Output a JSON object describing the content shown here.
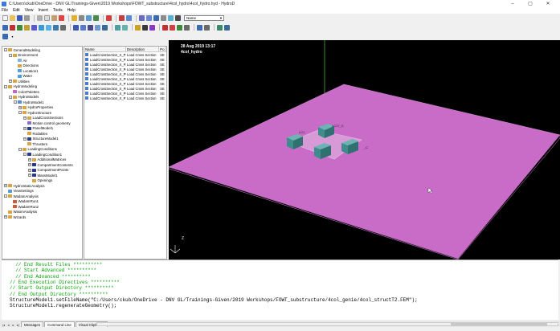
{
  "window": {
    "title": "C:\\Users\\ckub\\OneDrive - DNV GL\\Trainings-Given\\2019 Workshops\\FOWT_substructure\\4col_hydro\\4col_hydro.hyd - HydroD",
    "minimize": "–",
    "maximize": "▢",
    "close": "✕"
  },
  "menu": [
    "File",
    "Edit",
    "View",
    "Insert",
    "Tools",
    "Help"
  ],
  "toolbar": {
    "name_combo_value": "Name"
  },
  "tree": [
    {
      "label": "GeneralModeling",
      "depth": 0,
      "exp": "-",
      "color": "#d9a441"
    },
    {
      "label": "Environment",
      "depth": 1,
      "exp": "-",
      "color": "#d9a441"
    },
    {
      "label": "Air",
      "depth": 2,
      "exp": "",
      "color": "#7fb2e5"
    },
    {
      "label": "Directions",
      "depth": 2,
      "exp": "",
      "color": "#d9a441"
    },
    {
      "label": "Location1",
      "depth": 2,
      "exp": "",
      "color": "#5aa0d8"
    },
    {
      "label": "Water",
      "depth": 2,
      "exp": "",
      "color": "#4aa0e0"
    },
    {
      "label": "Utilities",
      "depth": 1,
      "exp": "+",
      "color": "#d9a441"
    },
    {
      "label": "HydroModeling",
      "depth": 0,
      "exp": "-",
      "color": "#d9a441"
    },
    {
      "label": "ColorPalettes",
      "depth": 1,
      "exp": "",
      "color": "#c06bc0"
    },
    {
      "label": "HydroModels",
      "depth": 1,
      "exp": "-",
      "color": "#d9a441"
    },
    {
      "label": "HydroModel1",
      "depth": 2,
      "exp": "-",
      "color": "#5a8ad0"
    },
    {
      "label": "HydroProperties",
      "depth": 3,
      "exp": "+",
      "color": "#d9a441"
    },
    {
      "label": "HydroStructure",
      "depth": 3,
      "exp": "-",
      "color": "#d9a441"
    },
    {
      "label": "LoadCrossSections",
      "depth": 4,
      "exp": "+",
      "color": "#d9a441"
    },
    {
      "label": "Motion control geometry",
      "depth": 4,
      "exp": "",
      "color": "#8a6ad0"
    },
    {
      "label": "PanelModel1",
      "depth": 4,
      "exp": "+",
      "color": "#2a3a8a"
    },
    {
      "label": "Rodables",
      "depth": 4,
      "exp": "",
      "color": "#d9a441"
    },
    {
      "label": "StructureModel1",
      "depth": 4,
      "exp": "+",
      "color": "#2a3a8a"
    },
    {
      "label": "Thrusters",
      "depth": 4,
      "exp": "",
      "color": "#d9a441"
    },
    {
      "label": "LoadingConditions",
      "depth": 3,
      "exp": "-",
      "color": "#d9a441"
    },
    {
      "label": "LoadingCondition1",
      "depth": 4,
      "exp": "-",
      "color": "#2a3a8a"
    },
    {
      "label": "AdditionalMatrices",
      "depth": 5,
      "exp": "+",
      "color": "#d9a441"
    },
    {
      "label": "CompartmentContents",
      "depth": 5,
      "exp": "+",
      "color": "#2a3a8a"
    },
    {
      "label": "CompartmentPoints",
      "depth": 5,
      "exp": "+",
      "color": "#2a3a8a"
    },
    {
      "label": "MassModel1",
      "depth": 5,
      "exp": "+",
      "color": "#2a3a8a"
    },
    {
      "label": "Openings",
      "depth": 5,
      "exp": "",
      "color": "#d9a441"
    },
    {
      "label": "HydroStaticAnalysis",
      "depth": 0,
      "exp": "+",
      "color": "#d9a441"
    },
    {
      "label": "ViewSettings",
      "depth": 0,
      "exp": "",
      "color": "#5a9ad0"
    },
    {
      "label": "WadamAnalysis",
      "depth": 0,
      "exp": "-",
      "color": "#d9a441"
    },
    {
      "label": "WadamRun1",
      "depth": 1,
      "exp": "",
      "color": "#d05a3a"
    },
    {
      "label": "WadamRun2",
      "depth": 1,
      "exp": "",
      "color": "#d05a3a"
    },
    {
      "label": "WasimAnalysis",
      "depth": 0,
      "exp": "",
      "color": "#d9a441"
    },
    {
      "label": "Wizards",
      "depth": 0,
      "exp": "+",
      "color": "#d9a441"
    }
  ],
  "list": {
    "headers": [
      "Name",
      "Description",
      "Po"
    ],
    "rows": [
      {
        "name": "LoadCrossSection_X_P1",
        "desc": "Load Cross Section",
        "po": "SE"
      },
      {
        "name": "LoadCrossSection_X_P2",
        "desc": "Load Cross Section",
        "po": "SE"
      },
      {
        "name": "LoadCrossSection_X_P3",
        "desc": "Load Cross Section",
        "po": "SE"
      },
      {
        "name": "LoadCrossSection_X_P4",
        "desc": "Load Cross Section",
        "po": "SE"
      },
      {
        "name": "LoadCrossSection_X_P5",
        "desc": "Load Cross Section",
        "po": "SE"
      },
      {
        "name": "LoadCrossSection_X_P6",
        "desc": "Load Cross Section",
        "po": "SE"
      },
      {
        "name": "LoadCrossSection_X_P7",
        "desc": "Load Cross Section",
        "po": "SE"
      },
      {
        "name": "LoadCrossSection_X_P8",
        "desc": "Load Cross Section",
        "po": "SE"
      },
      {
        "name": "LoadCrossSection_X_P9",
        "desc": "Load Cross Section",
        "po": "SE"
      },
      {
        "name": "LoadCrossSection_X_P10",
        "desc": "Load Cross Section",
        "po": "SE"
      }
    ]
  },
  "viewport": {
    "date": "28 Aug 2019 13:17",
    "model_name": "4col_hydro",
    "axis_z": "Z",
    "colors": {
      "background": "#000000",
      "plane": "#c86cc8",
      "columns": "#4a9a9a"
    }
  },
  "command_lines": [
    {
      "text": "  // End Result Files **********",
      "kind": "comment"
    },
    {
      "text": "  // Start Advanced **********",
      "kind": "comment"
    },
    {
      "text": "  // End Advanced **********",
      "kind": "comment"
    },
    {
      "text": "// End Execution Directives **********",
      "kind": "comment"
    },
    {
      "text": "// Start Output Directory **********",
      "kind": "comment"
    },
    {
      "text": "// End Output Directory **********",
      "kind": "comment"
    },
    {
      "text": "StructureModel1.setFileName(\"C:/Users/ckub/OneDrive - DNV GL/Trainings-Given/2019 Workshops/FOWT_substructure/4col_genie/4col_structT2.FEM\");",
      "kind": "code"
    },
    {
      "text": "StructureModel1.regenerateGeometry();",
      "kind": "code"
    }
  ],
  "tabs": [
    "Messages",
    "Command Line",
    "Visual Clipboard"
  ]
}
